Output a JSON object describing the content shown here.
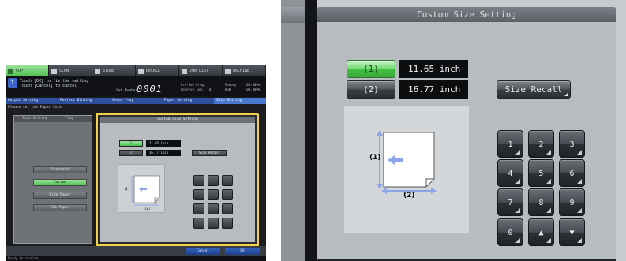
{
  "full_panel": {
    "tabs": [
      "COPY",
      "SCAN",
      "STORE",
      "RECALL",
      "JOB LIST",
      "MACHINE"
    ],
    "message_lines": [
      "Touch [OK] to fix the setting",
      "Touch [Cancel] to cancel"
    ],
    "set_number_label": "Set Number",
    "set_number": "0001",
    "pre_job_label": "Pre-Job Prog.",
    "reserve_label": "Reserve Job:",
    "reserve_count": "0",
    "memory_label": "Memory",
    "memory_value": "100.000%",
    "hdd_label": "HDD",
    "hdd_value": "100.000%",
    "breadcrumb": [
      "Output Setting",
      "Perfect Binding",
      "Cover Tray",
      "Paper Setting",
      "Size Setting"
    ],
    "paper_prompt": "Please set the Paper Size",
    "left_tabs": [
      "Size Setting",
      "Tray"
    ],
    "left_buttons": [
      "Standard",
      "Custom",
      "Wide Paper",
      "Tab Paper"
    ],
    "bottom_buttons": {
      "cancel": "Cancel",
      "ok": "OK"
    },
    "status_text": "Ready to receive"
  },
  "custom_size": {
    "title": "Custom Size Setting",
    "entries": [
      {
        "label": "(1)",
        "value": "11.65 inch",
        "selected": true
      },
      {
        "label": "(2)",
        "value": "16.77 inch",
        "selected": false
      }
    ],
    "size_recall_label": "Size Recall",
    "diagram_label_1": "(1)",
    "diagram_label_2": "(2)",
    "keypad": [
      "1",
      "2",
      "3",
      "4",
      "5",
      "6",
      "7",
      "8",
      "9",
      "0",
      "▲",
      "▼"
    ]
  },
  "colors": {
    "selected_green": "#4fbf4f",
    "highlight_frame": "#f1d14a",
    "dimension_arrow": "#8fa6e6"
  }
}
